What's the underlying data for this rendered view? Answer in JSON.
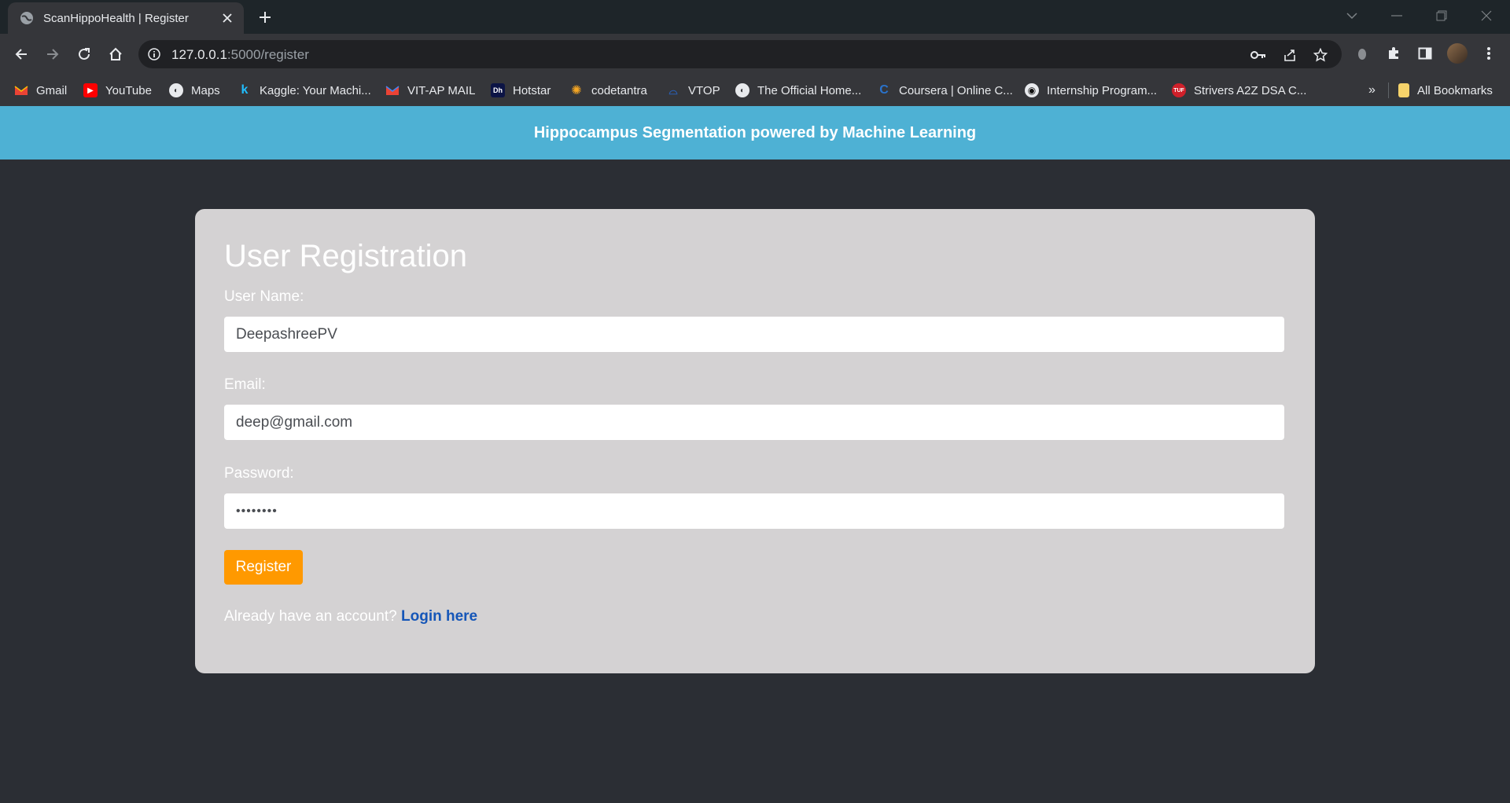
{
  "browser": {
    "tab_title": "ScanHippoHealth | Register",
    "url_host": "127.0.0.1",
    "url_path": ":5000/register",
    "bookmarks": [
      {
        "label": "Gmail",
        "icon": "gmail-icon"
      },
      {
        "label": "YouTube",
        "icon": "youtube-icon"
      },
      {
        "label": "Maps",
        "icon": "globe-icon"
      },
      {
        "label": "Kaggle: Your Machi...",
        "icon": "kaggle-icon"
      },
      {
        "label": "VIT-AP MAIL",
        "icon": "gmail-icon"
      },
      {
        "label": "Hotstar",
        "icon": "hotstar-icon"
      },
      {
        "label": "codetantra",
        "icon": "codetantra-icon"
      },
      {
        "label": "VTOP",
        "icon": "vtop-icon"
      },
      {
        "label": "The Official Home...",
        "icon": "globe-icon"
      },
      {
        "label": "Coursera | Online C...",
        "icon": "coursera-icon"
      },
      {
        "label": "Internship Program...",
        "icon": "internship-icon"
      },
      {
        "label": "Strivers A2Z DSA C...",
        "icon": "tuf-icon"
      }
    ],
    "overflow_label": "»",
    "all_bookmarks_label": "All Bookmarks"
  },
  "header": {
    "title": "Hippocampus Segmentation powered by Machine Learning"
  },
  "form": {
    "title": "User Registration",
    "username_label": "User Name:",
    "username_value": "DeepashreePV",
    "email_label": "Email:",
    "email_value": "deep@gmail.com",
    "password_label": "Password:",
    "password_value": "••••••••",
    "register_button": "Register",
    "login_prompt": "Already have an account? ",
    "login_link": "Login here"
  },
  "colors": {
    "header_bg": "#4eb1d4",
    "page_bg": "#2b2e34",
    "card_bg": "#d4d2d3",
    "button_bg": "#ff9900",
    "link": "#1556b8"
  }
}
